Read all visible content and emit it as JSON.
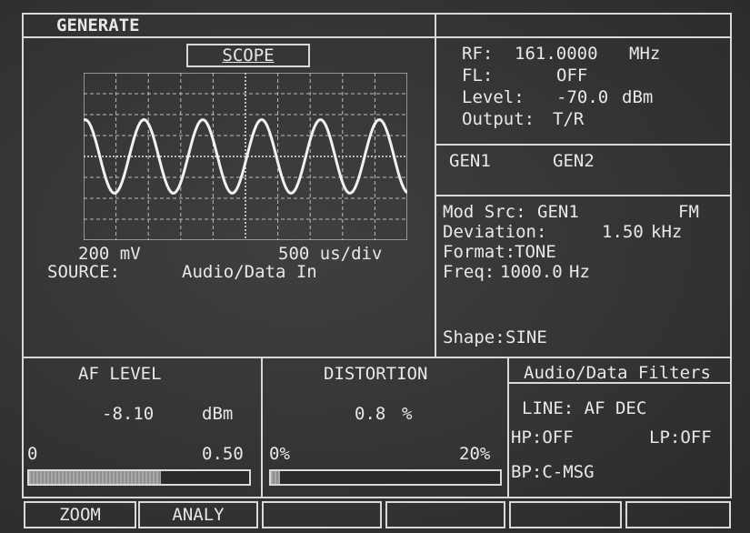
{
  "header": {
    "title": "GENERATE"
  },
  "scope": {
    "label": "SCOPE",
    "volts_div": "200 mV",
    "time_div": "500 us/div",
    "source_label": "SOURCE:",
    "source_value": "Audio/Data In",
    "waveform_cycles": 5.5
  },
  "rf": {
    "rf_label": "RF:",
    "rf_value": "161.0000",
    "rf_unit": "MHz",
    "fl_label": "FL:",
    "fl_value": "OFF",
    "level_label": "Level:",
    "level_value": "-70.0",
    "level_unit": "dBm",
    "output_label": "Output:",
    "output_value": "T/R"
  },
  "gen_tabs": [
    "GEN1",
    "GEN2"
  ],
  "mod": {
    "mod_src_label": "Mod Src:",
    "mod_src_value": "GEN1",
    "mod_type": "FM",
    "deviation_label": "Deviation:",
    "deviation_value": "1.50",
    "deviation_unit": "kHz",
    "format_label": "Format:",
    "format_value": "TONE",
    "freq_label": "Freq:",
    "freq_value": "1000.0",
    "freq_unit": "Hz",
    "shape_label": "Shape:",
    "shape_value": "SINE"
  },
  "af_level": {
    "title": "AF LEVEL",
    "value": "-8.10",
    "unit": "dBm",
    "scale_min": "0",
    "scale_max": "0.50",
    "bar_fraction": 0.6
  },
  "distortion": {
    "title": "DISTORTION",
    "value": "0.8",
    "unit": "%",
    "scale_min": "0%",
    "scale_max": "20%",
    "bar_fraction": 0.04
  },
  "filters": {
    "title": "Audio/Data Filters",
    "line": "LINE: AF DEC",
    "hp": "HP:OFF",
    "lp": "LP:OFF",
    "bp": "BP:C-MSG"
  },
  "softkeys": [
    "ZOOM",
    "ANALY",
    "",
    "",
    "",
    ""
  ]
}
